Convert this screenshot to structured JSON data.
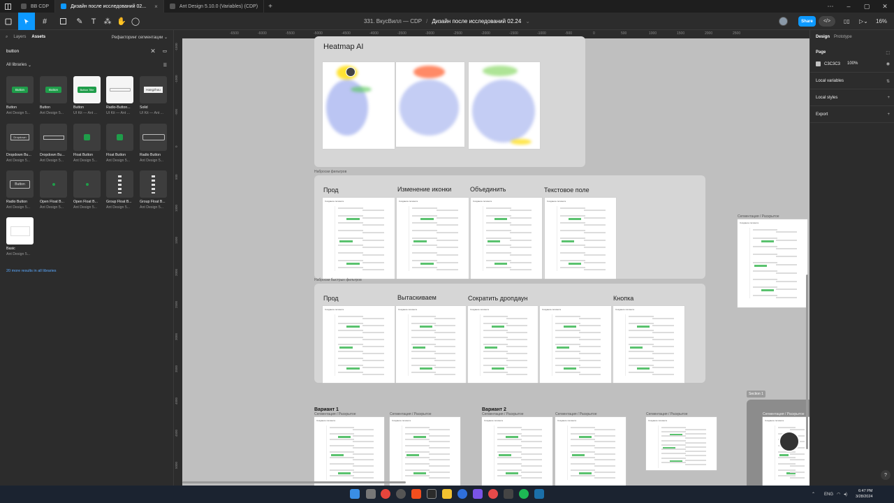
{
  "tabs": [
    {
      "label": "BB CDP",
      "active": false
    },
    {
      "label": "Дизайн после исследований 02...",
      "active": true
    },
    {
      "label": "Ant Design 5.10.0 (Variables) (CDP)",
      "active": false
    }
  ],
  "toolbar": {
    "project": "331. ВкусВилл — CDP",
    "file": "Дизайн после исследований 02.24",
    "share": "Share",
    "zoom": "16%"
  },
  "left_panel": {
    "tabs": [
      "Layers",
      "Assets"
    ],
    "page": "Рефакторинг сегментации",
    "search_value": "button",
    "library_filter": "All libraries",
    "assets": [
      {
        "name": "Button",
        "lib": "Ant Design 5..."
      },
      {
        "name": "Button",
        "lib": "Ant Design 5..."
      },
      {
        "name": "Button",
        "lib": "UI Kit — Ant ..."
      },
      {
        "name": "Radio-Button...",
        "lib": "UI Kit — Ant ..."
      },
      {
        "name": "Solid",
        "lib": "UI Kit — Ant ..."
      },
      {
        "name": "Dropdown Bu...",
        "lib": "Ant Design 5..."
      },
      {
        "name": "Dropdown Bu...",
        "lib": "Ant Design 5..."
      },
      {
        "name": "Float Button",
        "lib": "Ant Design 5..."
      },
      {
        "name": "Float Button",
        "lib": "Ant Design 5..."
      },
      {
        "name": "Radio Button",
        "lib": "Ant Design 5..."
      },
      {
        "name": "Radio Button",
        "lib": "Ant Design 5..."
      },
      {
        "name": "Open Float B...",
        "lib": "Ant Design 5..."
      },
      {
        "name": "Open Float B...",
        "lib": "Ant Design 5..."
      },
      {
        "name": "Group Float B...",
        "lib": "Ant Design 5..."
      },
      {
        "name": "Group Float B...",
        "lib": "Ant Design 5..."
      },
      {
        "name": "Basic",
        "lib": "Ant Design 5..."
      }
    ],
    "thumb_labels": {
      "button": "Button",
      "button_title": "Button Title",
      "hangzhou": "Hangzhou",
      "dropdown": "Dropdown"
    },
    "more_results": "20 more results in all libraries"
  },
  "canvas": {
    "ruler_top": [
      "-6500",
      "-6000",
      "-5500",
      "-5000",
      "-4500",
      "-4000",
      "-3500",
      "-3000",
      "-2500",
      "-2000",
      "-1500",
      "-1000",
      "-500",
      "0",
      "500",
      "1000",
      "1500",
      "2000",
      "2500"
    ],
    "ruler_left": [
      "-1500",
      "-1000",
      "-500",
      "0",
      "500",
      "1000",
      "1500",
      "2000",
      "2500",
      "3000",
      "3500",
      "4000",
      "4500",
      "5000"
    ],
    "heatmap_title": "Heatmap AI",
    "filters_label": "Наброски фильтров",
    "filters_titles": [
      "Прод",
      "Изменение иконки",
      "Объединить",
      "Текстовое поле"
    ],
    "quick_label": "Наброски быстрых фильтров",
    "quick_titles": [
      "Прод",
      "Вытаскиваем",
      "Сократить дропдаун",
      "Кнопка"
    ],
    "side_frame_label": "Сегментация / Раскрытое",
    "variant1": "Вариант 1",
    "variant2": "Вариант 2",
    "seg_label": "Сегментация / Раскрытое",
    "section_badge": "Section 1",
    "frame_header": "Создание сегмента"
  },
  "right_panel": {
    "tabs": [
      "Design",
      "Prototype"
    ],
    "page_title": "Page",
    "page_color": "C3C3C3",
    "page_opacity": "100%",
    "local_variables": "Local variables",
    "local_styles": "Local styles",
    "export": "Export",
    "help": "?"
  },
  "taskbar": {
    "lang": "ENG",
    "time": "6:47 PM",
    "date": "3/28/2024"
  },
  "colors": {
    "accent": "#0d99ff",
    "green": "#52c41a",
    "canvas": "#c3c3c3"
  }
}
